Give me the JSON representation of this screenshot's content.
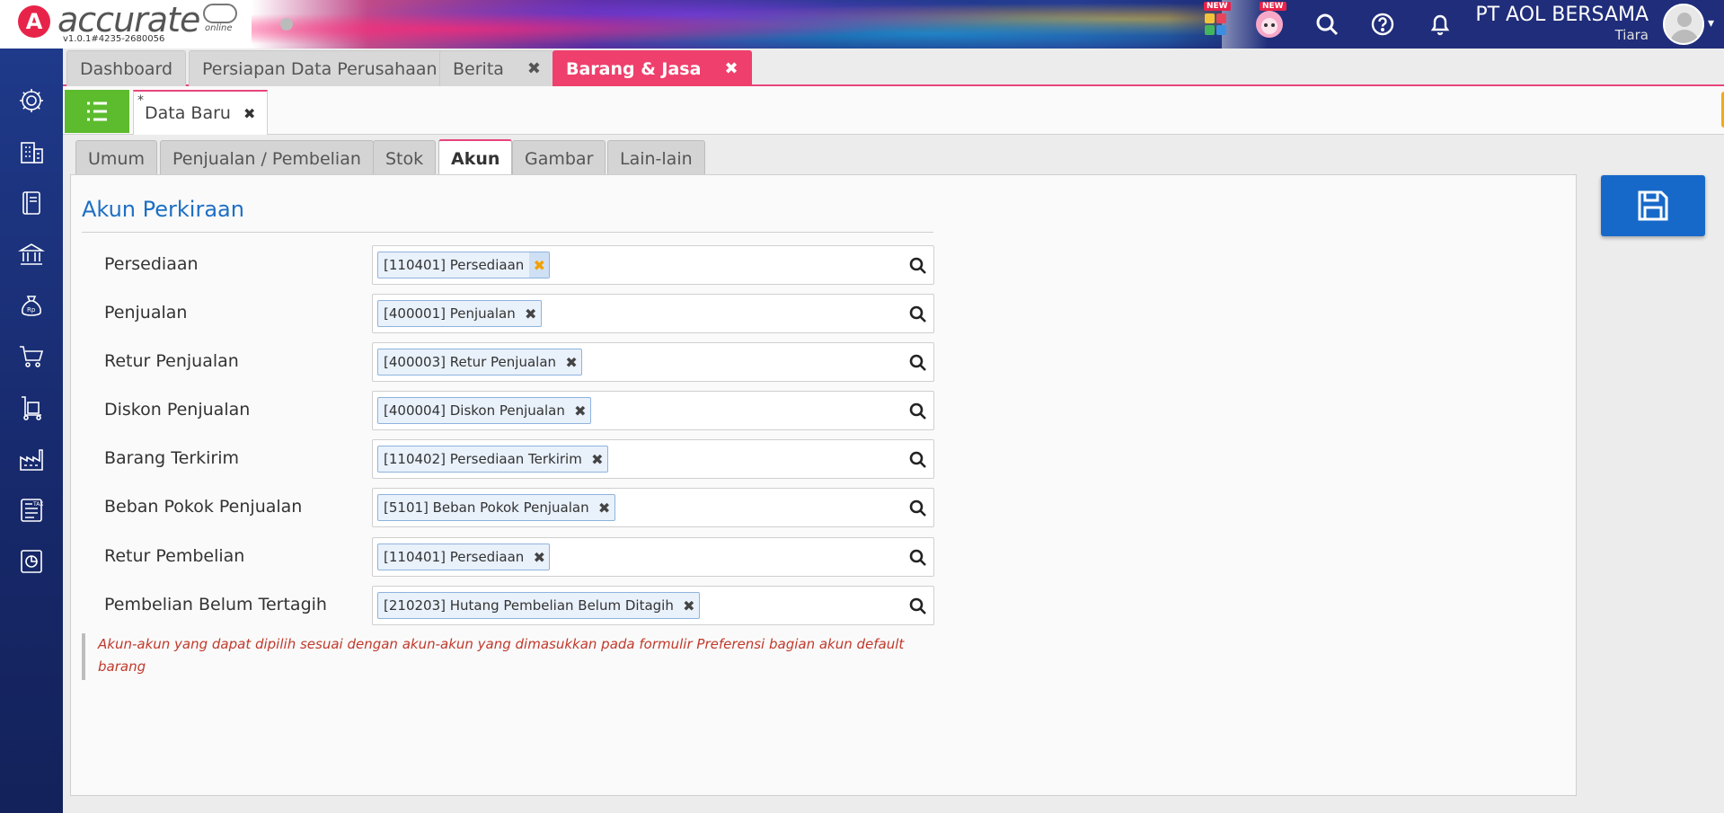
{
  "app": {
    "logo_text": "accurate",
    "logo_sub": "online",
    "version": "v1.0.1#4235-2680056",
    "company": "PT AOL BERSAMA",
    "user": "Tiara",
    "badge_new": "NEW"
  },
  "main_tabs": [
    {
      "label": "Dashboard",
      "closable": false
    },
    {
      "label": "Persiapan Data Perusahaan",
      "closable": false
    },
    {
      "label": "Berita",
      "closable": true
    },
    {
      "label": "Barang & Jasa",
      "closable": true,
      "active": true
    }
  ],
  "tab_count": "4",
  "sub_tab": {
    "star": "*",
    "label": "Data Baru"
  },
  "form_tabs": [
    "Umum",
    "Penjualan / Pembelian",
    "Stok",
    "Akun",
    "Gambar",
    "Lain-lain"
  ],
  "active_form_tab": "Akun",
  "section_title": "Akun Perkiraan",
  "fields": [
    {
      "label": "Persediaan",
      "value": "[110401] Persediaan"
    },
    {
      "label": "Penjualan",
      "value": "[400001] Penjualan"
    },
    {
      "label": "Retur Penjualan",
      "value": "[400003] Retur Penjualan"
    },
    {
      "label": "Diskon Penjualan",
      "value": "[400004] Diskon Penjualan"
    },
    {
      "label": "Barang Terkirim",
      "value": "[110402] Persediaan Terkirim"
    },
    {
      "label": "Beban Pokok Penjualan",
      "value": "[5101] Beban Pokok Penjualan"
    },
    {
      "label": "Retur Pembelian",
      "value": "[110401] Persediaan"
    },
    {
      "label": "Pembelian Belum Tertagih",
      "value": "[210203] Hutang Pembelian Belum Ditagih"
    }
  ],
  "note": "Akun-akun yang dapat dipilih sesuai dengan akun-akun yang dimasukkan pada formulir Preferensi bagian akun default barang",
  "colors": {
    "accent_pink": "#ef3f6c",
    "title_blue": "#1e6fc4",
    "save_blue": "#1769c9",
    "list_green": "#5dbb2e",
    "bulb_orange": "#f6a81a",
    "note_red": "#c0392b",
    "sidebar_navy": "#1f3a8a"
  },
  "icons": {
    "sidebar": [
      "gear-icon",
      "building-icon",
      "book-icon",
      "bank-icon",
      "money-bag-icon",
      "cart-icon",
      "hand-truck-icon",
      "factory-icon",
      "tax-icon",
      "report-icon"
    ],
    "header": [
      "apps-icon",
      "mascot-icon",
      "search-icon",
      "help-icon",
      "bell-icon"
    ]
  }
}
